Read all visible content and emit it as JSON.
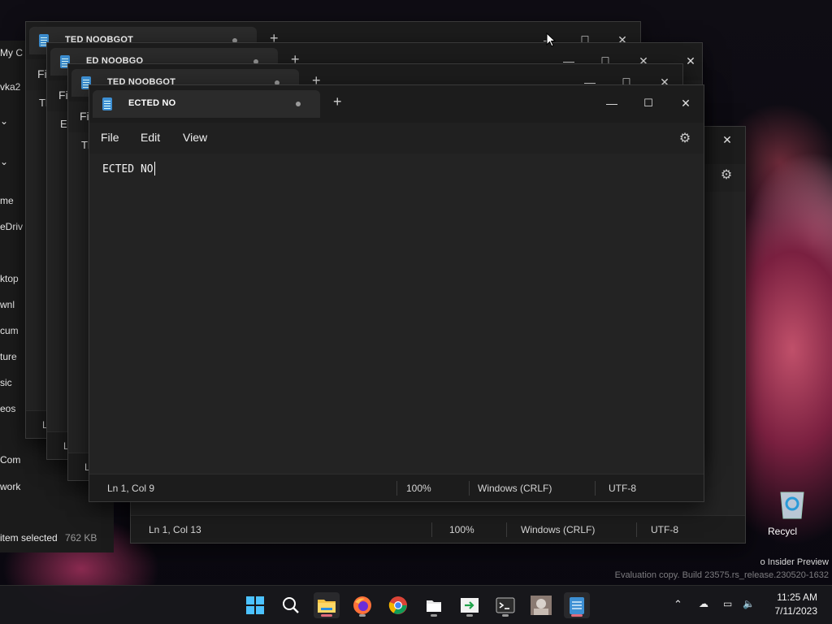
{
  "explorer": {
    "rows": [
      "My C",
      "vka2",
      "me",
      "eDriv",
      "ktop",
      "wnl",
      "cum",
      "ture",
      "sic",
      "eos",
      "Com",
      "work"
    ],
    "status_selected": "item selected",
    "status_size": "762 KB"
  },
  "back_windows": [
    {
      "title": "TED NOOBGOT",
      "menu_file": "Fil",
      "line": "Tl",
      "status_ln": "L"
    },
    {
      "title": "ED NOOBGO",
      "menu_file": "Fil",
      "line": "El",
      "status_ln": "L"
    },
    {
      "title": "TED NOOBGOT",
      "menu_file": "Fi",
      "line": "Tl",
      "status_ln": "L"
    }
  ],
  "under_window": {
    "status_ln": "Ln 1, Col 13",
    "status_zoom": "100%",
    "status_eol": "Windows (CRLF)",
    "status_enc": "UTF-8"
  },
  "notepad": {
    "tab_title": "ECTED NO",
    "menu": {
      "file": "File",
      "edit": "Edit",
      "view": "View"
    },
    "content": "ECTED NO",
    "status": {
      "ln": "Ln 1, Col 9",
      "zoom": "100%",
      "eol": "Windows (CRLF)",
      "enc": "UTF-8"
    }
  },
  "desktop": {
    "recycle_bin": "Recycl",
    "watermark_line1": "o Insider Preview",
    "watermark_line2": "Evaluation copy. Build 23575.rs_release.230520-1632"
  },
  "taskbar": {
    "apps": [
      "start-icon",
      "search-icon",
      "file-explorer-icon",
      "firefox-icon",
      "chrome-icon",
      "files-icon",
      "terminal-green-icon",
      "terminal-icon",
      "photo-icon",
      "notepad-icon"
    ],
    "time": "11:25 AM",
    "date": "7/11/2023"
  },
  "colors": {
    "window_bg": "#202020",
    "accent_notepad": "#3d8fd3",
    "taskbar_active_indicator": "#e06a7a"
  }
}
